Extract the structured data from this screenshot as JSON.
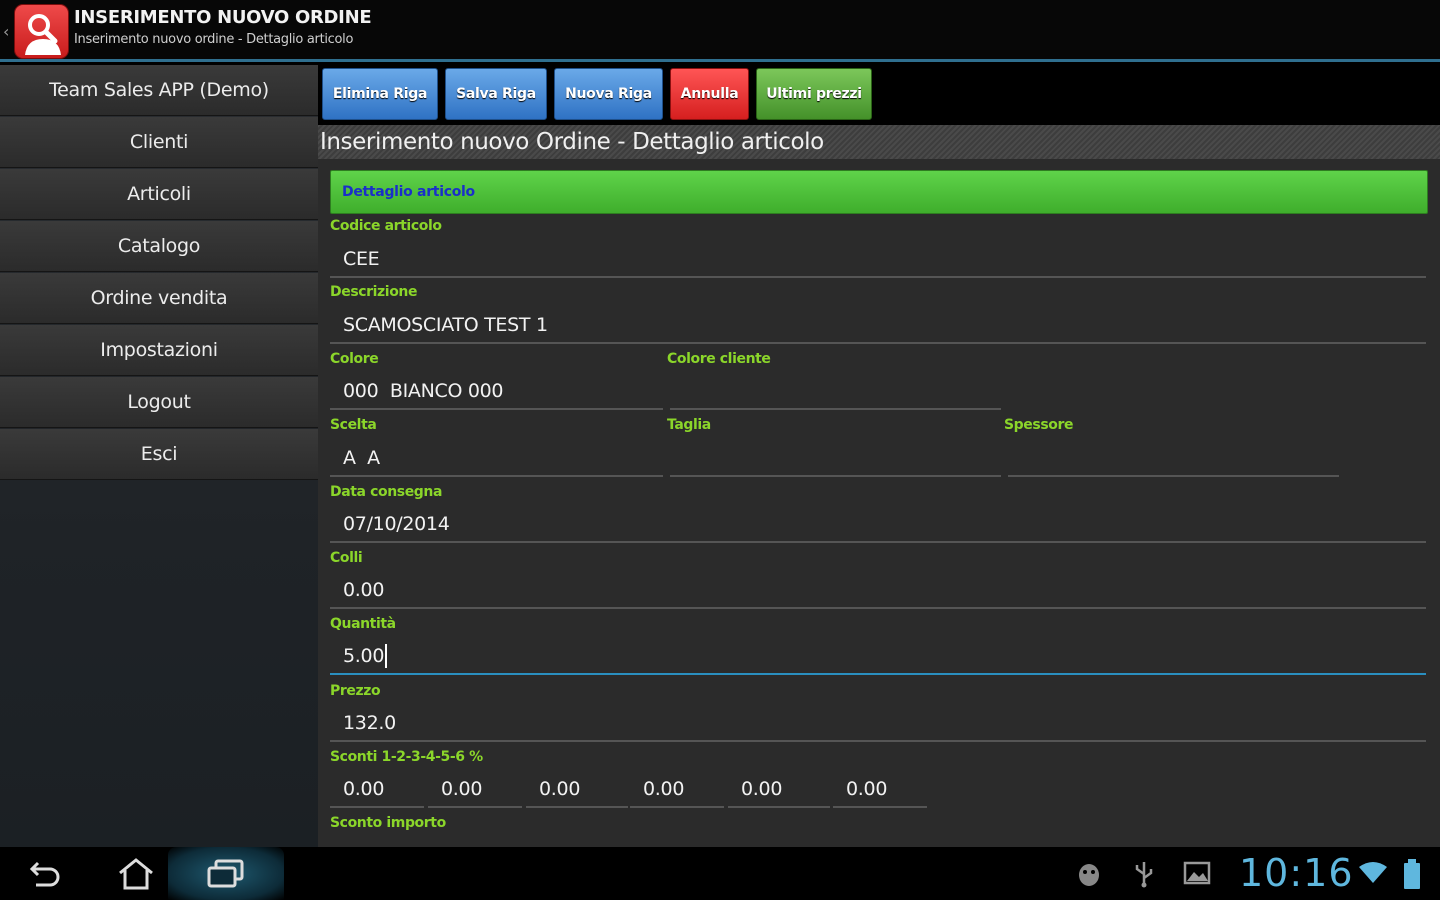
{
  "app": {
    "title": "INSERIMENTO NUOVO ORDINE",
    "subtitle": "Inserimento nuovo ordine - Dettaglio articolo",
    "icon": "app-logo-icon",
    "back_glyph": "‹"
  },
  "sidebar": {
    "items": [
      {
        "label": "Team Sales APP (Demo)"
      },
      {
        "label": "Clienti"
      },
      {
        "label": "Articoli"
      },
      {
        "label": "Catalogo"
      },
      {
        "label": "Ordine vendita"
      },
      {
        "label": "Impostazioni"
      },
      {
        "label": "Logout"
      },
      {
        "label": "Esci"
      }
    ]
  },
  "toolbar": {
    "elimina": "Elimina Riga",
    "salva": "Salva Riga",
    "nuova": "Nuova Riga",
    "annulla": "Annulla",
    "ultimi": "Ultimi prezzi"
  },
  "header": {
    "title": "Inserimento nuovo Ordine - Dettaglio articolo"
  },
  "form": {
    "section_title": "Dettaglio articolo",
    "codice": {
      "label": "Codice articolo",
      "value": "CEE"
    },
    "descrizione": {
      "label": "Descrizione",
      "value": "SCAMOSCIATO TEST 1"
    },
    "colore": {
      "label": "Colore",
      "value": "000  BIANCO 000"
    },
    "colore_cliente": {
      "label": "Colore cliente",
      "value": ""
    },
    "scelta": {
      "label": "Scelta",
      "value": "A  A"
    },
    "taglia": {
      "label": "Taglia",
      "value": ""
    },
    "spessore": {
      "label": "Spessore",
      "value": ""
    },
    "data_consegna": {
      "label": "Data consegna",
      "value": "07/10/2014"
    },
    "colli": {
      "label": "Colli",
      "value": "0.00"
    },
    "quantita": {
      "label": "Quantità",
      "value": "5.00"
    },
    "prezzo": {
      "label": "Prezzo",
      "value": "132.0"
    },
    "sconti": {
      "label": "Sconti 1-2-3-4-5-6 %",
      "values": [
        "0.00",
        "0.00",
        "0.00",
        "0.00",
        "0.00",
        "0.00"
      ]
    },
    "sconto_importo": {
      "label": "Sconto importo"
    }
  },
  "statusbar": {
    "time": "10:16",
    "icons": [
      "android-debug-icon",
      "usb-icon",
      "gallery-notification-icon",
      "wifi-icon",
      "battery-icon"
    ]
  },
  "colors": {
    "label_green": "#8bd62a",
    "section_green": "#4fc23a",
    "section_text": "#1a2fc9",
    "button_blue": "#3f86d6",
    "button_red": "#e83232",
    "button_green": "#5aa83a",
    "clock_blue": "#5fb7de"
  }
}
